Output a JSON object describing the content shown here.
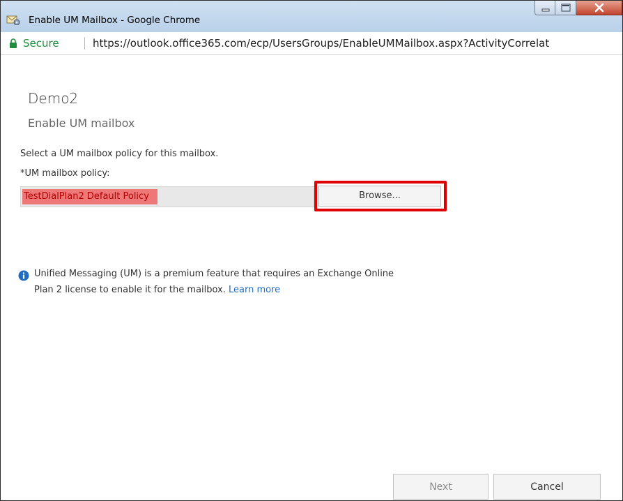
{
  "window": {
    "title": "Enable UM Mailbox - Google Chrome",
    "app_icon": "mailbox-gear-icon",
    "controls": [
      "minimize-icon",
      "maximize-icon",
      "close-icon"
    ]
  },
  "addressbar": {
    "secure_label": "Secure",
    "lock_icon": "lock-icon",
    "url": "https://outlook.office365.com/ecp/UsersGroups/EnableUMMailbox.aspx?ActivityCorrelat"
  },
  "page": {
    "title": "Demo2",
    "subtitle": "Enable UM mailbox",
    "instruction": "Select a UM mailbox policy for this mailbox.",
    "policy_label": "*UM mailbox policy:",
    "policy_value": "TestDialPlan2 Default Policy",
    "browse_label": "Browse...",
    "info_icon": "info-icon",
    "info_line1": "Unified Messaging (UM) is a premium feature that requires an Exchange Online",
    "info_line2": "Plan 2 license to enable it for the mailbox.",
    "learn_more": "Learn more"
  },
  "footer": {
    "next_label": "Next",
    "cancel_label": "Cancel"
  },
  "colors": {
    "highlight_border": "#e00000",
    "policy_highlight": "#ee7878",
    "secure_green": "#1e8e3e",
    "link_blue": "#1f6cc2",
    "info_blue": "#1f6cc2"
  }
}
